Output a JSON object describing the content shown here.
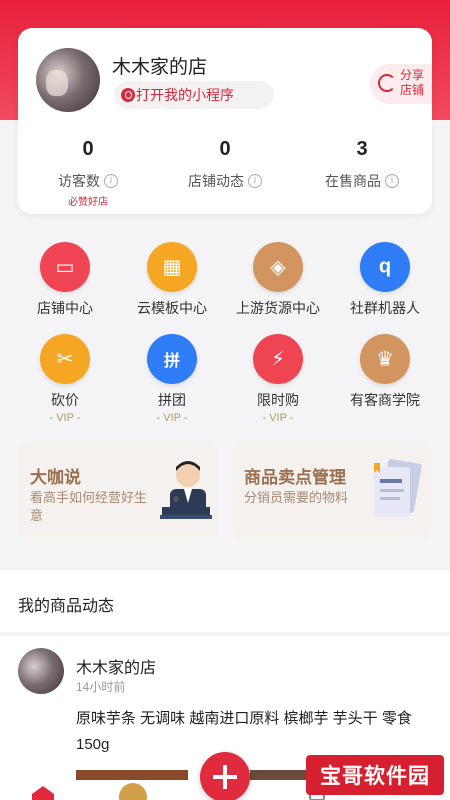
{
  "store": {
    "name": "木木家的店",
    "mini_program_label": "打开我的小程序",
    "share_label": "分享店铺"
  },
  "stats": [
    {
      "value": "0",
      "label": "访客数",
      "sub": "必赞好店"
    },
    {
      "value": "0",
      "label": "店铺动态",
      "sub": ""
    },
    {
      "value": "3",
      "label": "在售商品",
      "sub": ""
    }
  ],
  "grid": [
    {
      "label": "店铺中心",
      "icon": "store-icon",
      "color": "#ef4552",
      "glyph": "▭",
      "vip": ""
    },
    {
      "label": "云模板中心",
      "icon": "template-icon",
      "color": "#f5a623",
      "glyph": "▦",
      "vip": ""
    },
    {
      "label": "上游货源中心",
      "icon": "box-icon",
      "color": "#d3955f",
      "glyph": "◈",
      "vip": ""
    },
    {
      "label": "社群机器人",
      "icon": "robot-icon",
      "color": "#2e7cf6",
      "glyph": "q",
      "vip": ""
    },
    {
      "label": "砍价",
      "icon": "bargain-icon",
      "color": "#f5a623",
      "glyph": "✂",
      "vip": "- VIP -"
    },
    {
      "label": "拼团",
      "icon": "group-icon",
      "color": "#2e7cf6",
      "glyph": "拼",
      "vip": "- VIP -"
    },
    {
      "label": "限时购",
      "icon": "flash-sale-icon",
      "color": "#ef4552",
      "glyph": "⚡",
      "vip": "- VIP -"
    },
    {
      "label": "有客商学院",
      "icon": "crown-icon",
      "color": "#d3955f",
      "glyph": "♛",
      "vip": ""
    }
  ],
  "promos": [
    {
      "title": "大咖说",
      "subtitle": "看高手如何经营好生意"
    },
    {
      "title": "商品卖点管理",
      "subtitle": "分销员需要的物料"
    }
  ],
  "section_title": "我的商品动态",
  "feed": {
    "name": "木木家的店",
    "time": "14小时前",
    "text": "原味芋条 无调味 越南进口原料 槟榔芋 芋头干 零食 150g"
  },
  "watermark": "宝哥软件园"
}
